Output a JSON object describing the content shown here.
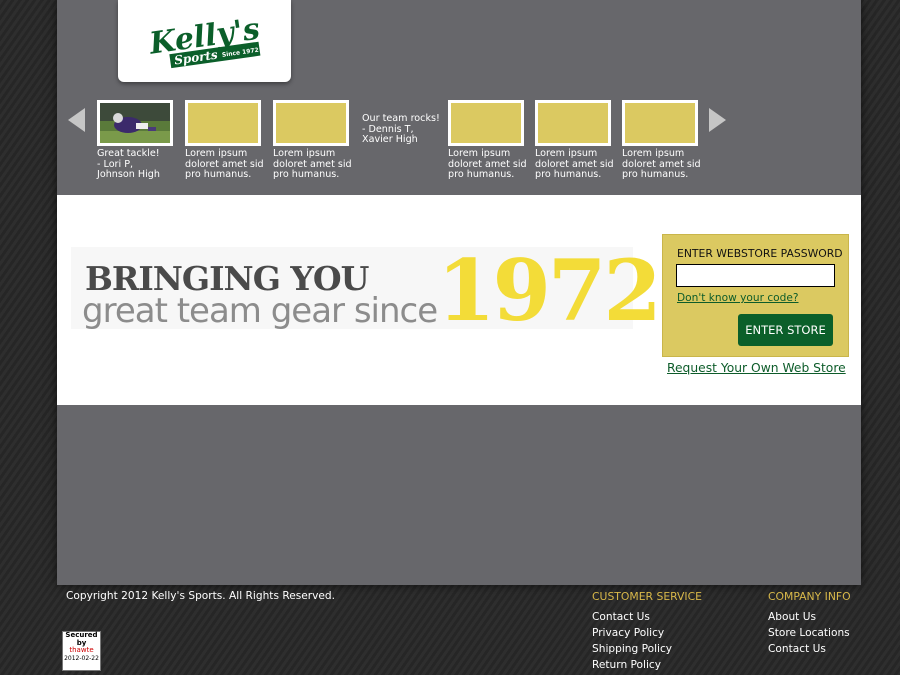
{
  "brand": {
    "name": "Kelly's",
    "sub": "Sports",
    "since": "Since 1972",
    "colors": {
      "green": "#0b5f2a",
      "gold": "#dbc961",
      "yellow": "#f3dc38"
    }
  },
  "carousel": {
    "prev_icon": "arrow-left-icon",
    "next_icon": "arrow-right-icon",
    "items": [
      {
        "caption": "Great tackle!\n- Lori P,\nJohnson High",
        "has_photo": true
      },
      {
        "caption": "Lorem ipsum\ndoloret amet sid\npro humanus."
      },
      {
        "caption": "Lorem ipsum\ndoloret amet sid\npro humanus."
      },
      {
        "caption": "Lorem ipsum\ndoloret amet sid\npro humanus."
      },
      {
        "caption": "Lorem ipsum\ndoloret amet sid\npro humanus."
      },
      {
        "caption": "Lorem ipsum\ndoloret amet sid\npro humanus."
      }
    ],
    "quote": "Our team rocks!\n- Dennis T,\nXavier High"
  },
  "banner": {
    "line1": "BRINGING YOU",
    "line2": "great team gear since",
    "year": "1972"
  },
  "webstore": {
    "label": "ENTER WEBSTORE PASSWORD",
    "password_value": "",
    "forgot_link": "Don't know your code?",
    "enter_button": "ENTER STORE",
    "request_link": "Request Your Own Web Store"
  },
  "footer": {
    "copyright": "Copyright 2012 Kelly's Sports. All Rights Reserved.",
    "secured_badge": {
      "line1": "Secured",
      "line2": "by",
      "line3": "thawte",
      "date": "2012-02-22"
    },
    "customer_service": {
      "heading": "CUSTOMER SERVICE",
      "links": [
        "Contact Us",
        "Privacy Policy",
        "Shipping Policy",
        "Return Policy"
      ]
    },
    "company_info": {
      "heading": "COMPANY INFO",
      "links": [
        "About Us",
        "Store Locations",
        "Contact Us"
      ]
    }
  }
}
